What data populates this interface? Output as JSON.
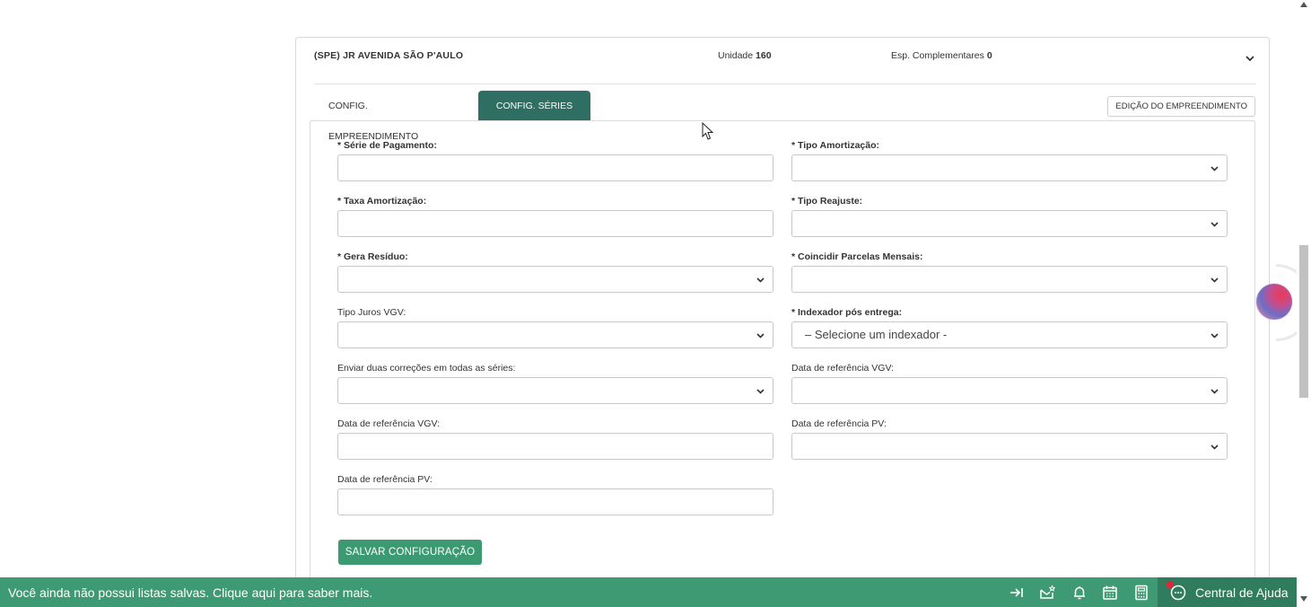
{
  "header": {
    "title": "(SPE) JR AVENIDA SÃO P'AULO",
    "unit_label": "Unidade",
    "unit_value": "160",
    "esp_label": "Esp. Complementares",
    "esp_value": "0"
  },
  "tabs": [
    {
      "label": "CONFIG. EMPREENDIMENTO",
      "active": false
    },
    {
      "label": "CONFIG. SÉRIES",
      "active": true
    }
  ],
  "edit_button": "EDIÇÃO DO EMPREENDIMENTO",
  "fields": {
    "serie_pagamento": {
      "label": "* Série de Pagamento:",
      "value": ""
    },
    "tipo_amortizacao": {
      "label": "* Tipo Amortização:",
      "value": ""
    },
    "taxa_amortizacao": {
      "label": "* Taxa Amortização:",
      "value": ""
    },
    "tipo_reajuste": {
      "label": "* Tipo Reajuste:",
      "value": ""
    },
    "gera_residuo": {
      "label": "* Gera Resíduo:",
      "value": ""
    },
    "coincidir_parcelas": {
      "label": "* Coincidir Parcelas Mensais:",
      "value": ""
    },
    "tipo_juros_vgv": {
      "label": "Tipo Juros VGV:",
      "value": ""
    },
    "indexador_pos_entrega": {
      "label": "* Indexador pós entrega:",
      "value": "– Selecione um indexador -"
    },
    "enviar_duas_correcoes": {
      "label": "Enviar duas correções em todas as séries:",
      "value": ""
    },
    "data_ref_vgv_select": {
      "label": "Data de referência VGV:",
      "value": ""
    },
    "data_ref_vgv_input": {
      "label": "Data de referência VGV:",
      "value": ""
    },
    "data_ref_pv_select": {
      "label": "Data de referência PV:",
      "value": ""
    },
    "data_ref_pv_input": {
      "label": "Data de referência PV:",
      "value": ""
    }
  },
  "save_button": "SALVAR CONFIGURAÇÃO",
  "footer": {
    "message": "Você ainda não possui listas salvas. Clique aqui para saber mais.",
    "help_label": "Central de Ajuda"
  },
  "colors": {
    "active_tab": "#2f6f63",
    "save_button": "#3c9a73",
    "footer": "#3e9a72",
    "help": "#2f7d5e"
  },
  "icons": [
    "chevron-down-icon",
    "collapse-sidebar-icon",
    "mail-star-icon",
    "bell-icon",
    "calendar-icon",
    "calculator-icon",
    "chat-help-icon"
  ]
}
